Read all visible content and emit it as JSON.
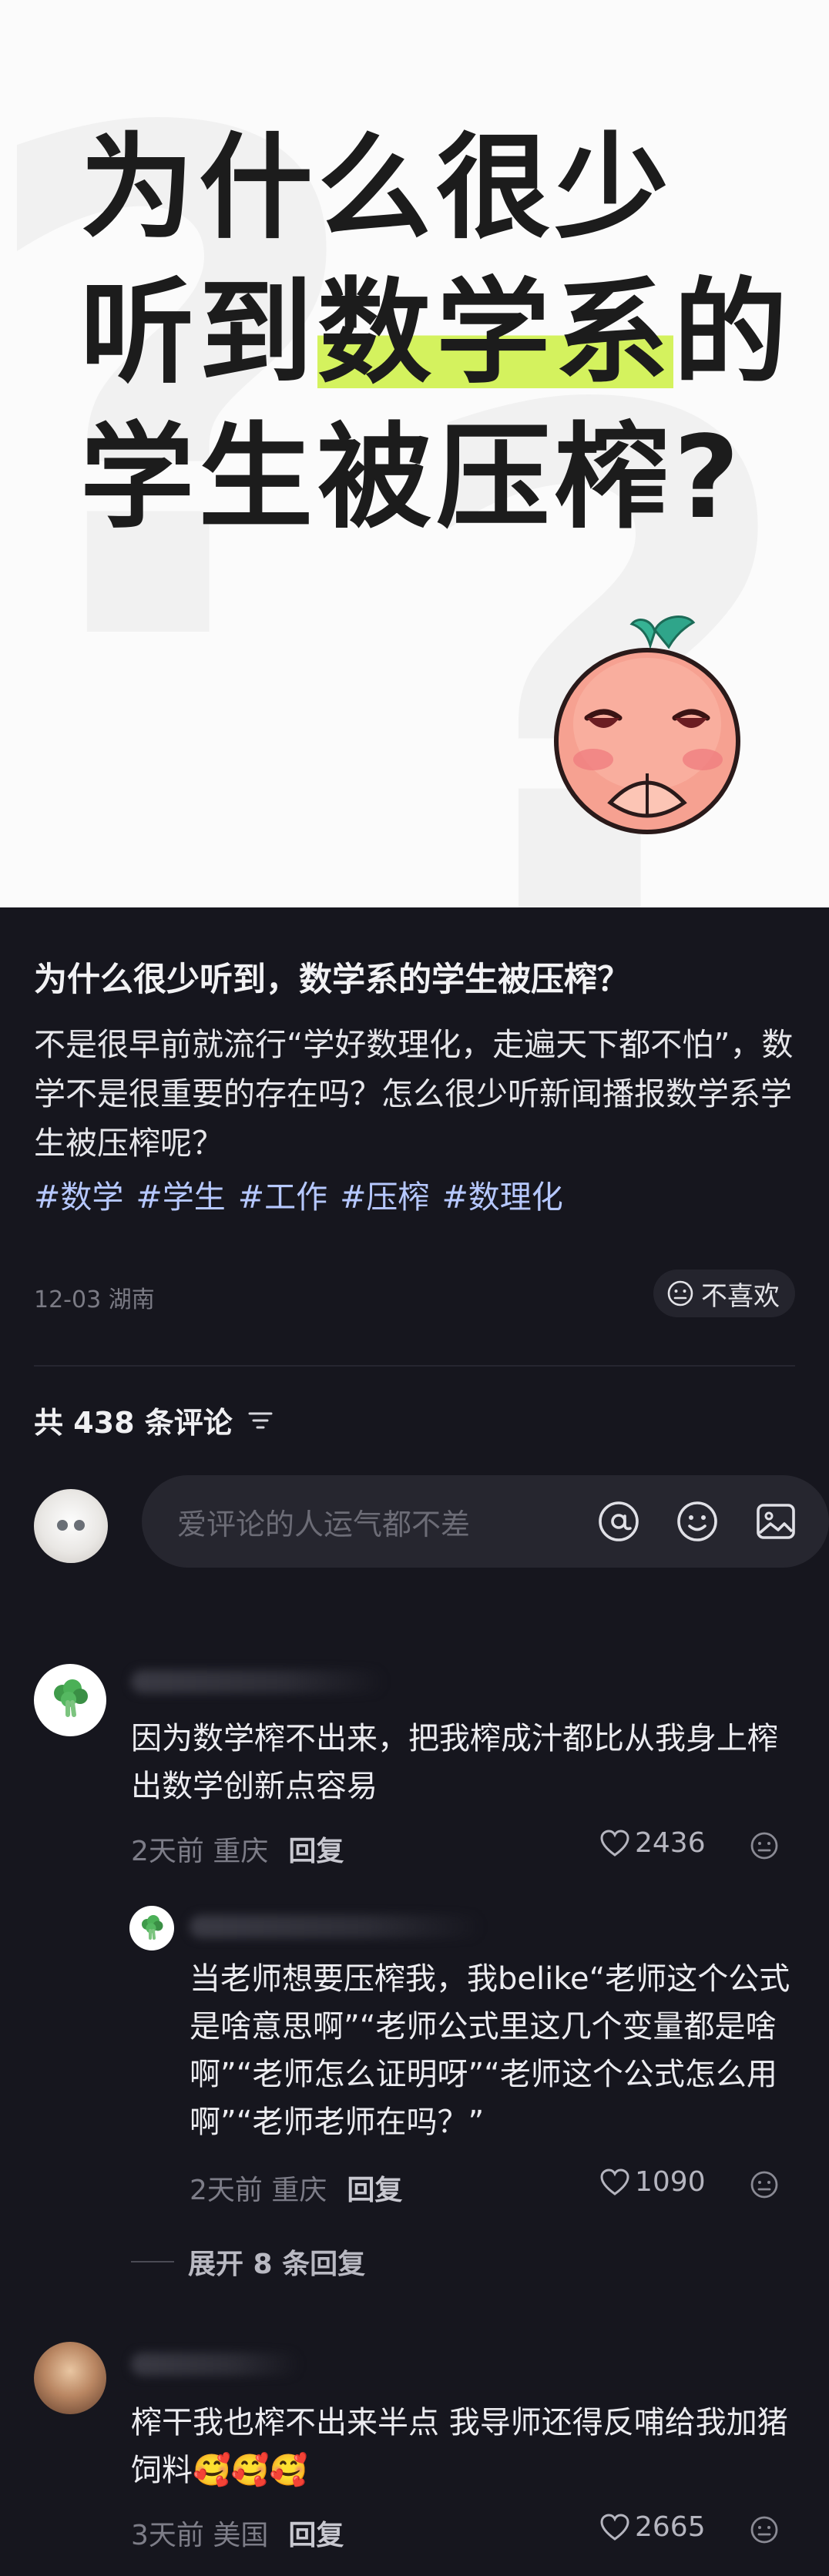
{
  "cover": {
    "title_line1": "为什么很少",
    "title_line2_pre": "听到",
    "title_line2_hl": "数学系",
    "title_line2_post": "的",
    "title_line3": "学生被压榨?",
    "highlight_color": "#d4f25e"
  },
  "post": {
    "title": "为什么很少听到，数学系的学生被压榨？",
    "body": "不是很早前就流行“学好数理化，走遍天下都不怕”，数学不是很重要的存在吗？怎么很少听新闻播报数学系学生被压榨呢？",
    "tags": [
      "#数学",
      "#学生",
      "#工作",
      "#压榨",
      "#数理化"
    ],
    "meta": "12-03 湖南",
    "dislike_label": "不喜欢"
  },
  "comments_section": {
    "header": "共 438 条评论",
    "input_placeholder": "爱评论的人运气都不差",
    "icons": [
      "at-icon",
      "emoji-icon",
      "image-icon"
    ]
  },
  "comments": [
    {
      "text": "因为数学榨不出来，把我榨成汁都比从我身上榨出数学创新点容易",
      "time": "2天前",
      "location": "重庆",
      "reply_label": "回复",
      "likes": "2436"
    },
    {
      "text": "当老师想要压榨我，我belike“老师这个公式是啥意思啊”“老师公式里这几个变量都是啥啊”“老师怎么证明呀”“老师这个公式怎么用啊”“老师老师在吗？”",
      "time": "2天前",
      "location": "重庆",
      "reply_label": "回复",
      "likes": "1090",
      "expand_label": "展开 8 条回复"
    },
    {
      "text": "榨干我也榨不出来半点 我导师还得反哺给我加猪饲料",
      "emoji": "🥰🥰🥰",
      "time": "3天前",
      "location": "美国",
      "reply_label": "回复",
      "likes": "2665"
    }
  ]
}
